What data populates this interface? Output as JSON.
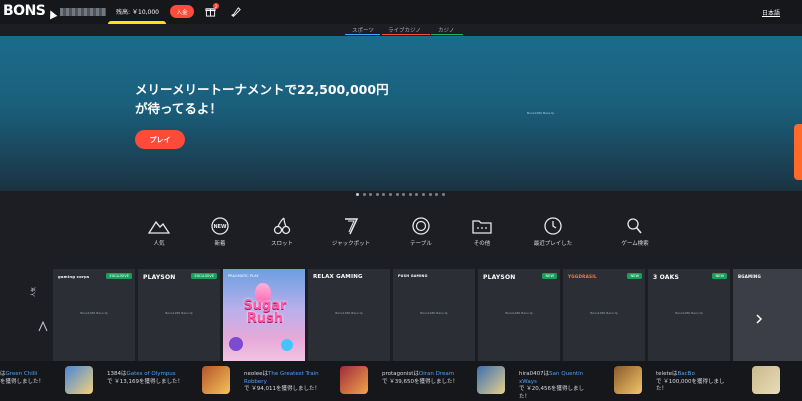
{
  "header": {
    "logo": "BONS",
    "balance_label": "残高:",
    "balance_value": "￥10,000",
    "deposit_label": "入金",
    "gift_badge": "2",
    "language": "日本語"
  },
  "category_tabs": [
    {
      "label": "スポーツ",
      "color": "#3fa7ff"
    },
    {
      "label": "ライブカジノ",
      "color": "#ff4b3a"
    },
    {
      "label": "カジノ",
      "color": "#1fae63"
    }
  ],
  "hero": {
    "title": "メリーメリートーナメントで22,500,000円が待ってるよ！",
    "play_label": "プレイ",
    "image_tag": "Bons1280 Bans tp"
  },
  "slider_dots": 14,
  "nav": [
    {
      "label": "人気",
      "icon": "mountain-icon"
    },
    {
      "label": "新着",
      "icon": "new-icon"
    },
    {
      "label": "スロット",
      "icon": "cherry-icon"
    },
    {
      "label": "ジャックポット",
      "icon": "seven-icon"
    },
    {
      "label": "テーブル",
      "icon": "chip-icon"
    },
    {
      "label": "その他",
      "icon": "folder-icon"
    },
    {
      "label": "最近プレイした",
      "icon": "clock-icon"
    },
    {
      "label": "ゲーム検索",
      "icon": "search-icon"
    }
  ],
  "section_label": "人気",
  "games": [
    {
      "provider": "gaming corps",
      "badge": "EXCLUSIVE",
      "loading": "Bons1280 Bans tp"
    },
    {
      "provider": "PLAYSON",
      "badge": "EXCLUSIVE",
      "loading": "Bons1280 Bans tp"
    },
    {
      "provider": "PRAGMATIC PLAY",
      "badge": "",
      "title": "Sugar Rush",
      "loading": ""
    },
    {
      "provider": "RELAX GAMING",
      "badge": "",
      "loading": "Bons1280 Bans tp"
    },
    {
      "provider": "PUSH GAMING",
      "badge": "",
      "loading": "Bons1280 Bans tp"
    },
    {
      "provider": "PLAYSON",
      "badge": "NEW",
      "loading": "Bons1280 Bans tp"
    },
    {
      "provider": "YGGDRASIL",
      "badge": "NEW",
      "loading": "Bons1280 Bans tp"
    },
    {
      "provider": "3 OAKS",
      "badge": "NEW",
      "loading": "Bons1280 Bans tp"
    },
    {
      "provider": "BGAMING",
      "badge": "",
      "loading": ""
    }
  ],
  "ticker": [
    {
      "line1": "は",
      "game": "Green Chilli",
      "line2": "を獲得しました！",
      "amount": "¥"
    },
    {
      "line1": "1384は",
      "game": "Gates of Olympus",
      "line2": "で ￥13,169を獲得しました！"
    },
    {
      "line1": "neoleeは",
      "game": "The Greatest Train Robbery",
      "line2": "で ￥94,011を獲得しました！"
    },
    {
      "line1": "protagonistは",
      "game": "Oiran Dream",
      "line2": "で ￥39,650を獲得しました！"
    },
    {
      "line1": "hira0407は",
      "game": "San Quentin xWays",
      "line2": "で ￥20,456を獲得しました！"
    },
    {
      "line1": "teleteは",
      "game": "BacBo",
      "line2": "で ￥100,000を獲得しました！"
    }
  ],
  "colors": {
    "accent": "#ff4b3a",
    "highlight": "#ffe01a",
    "badge_green": "#18a05a"
  }
}
